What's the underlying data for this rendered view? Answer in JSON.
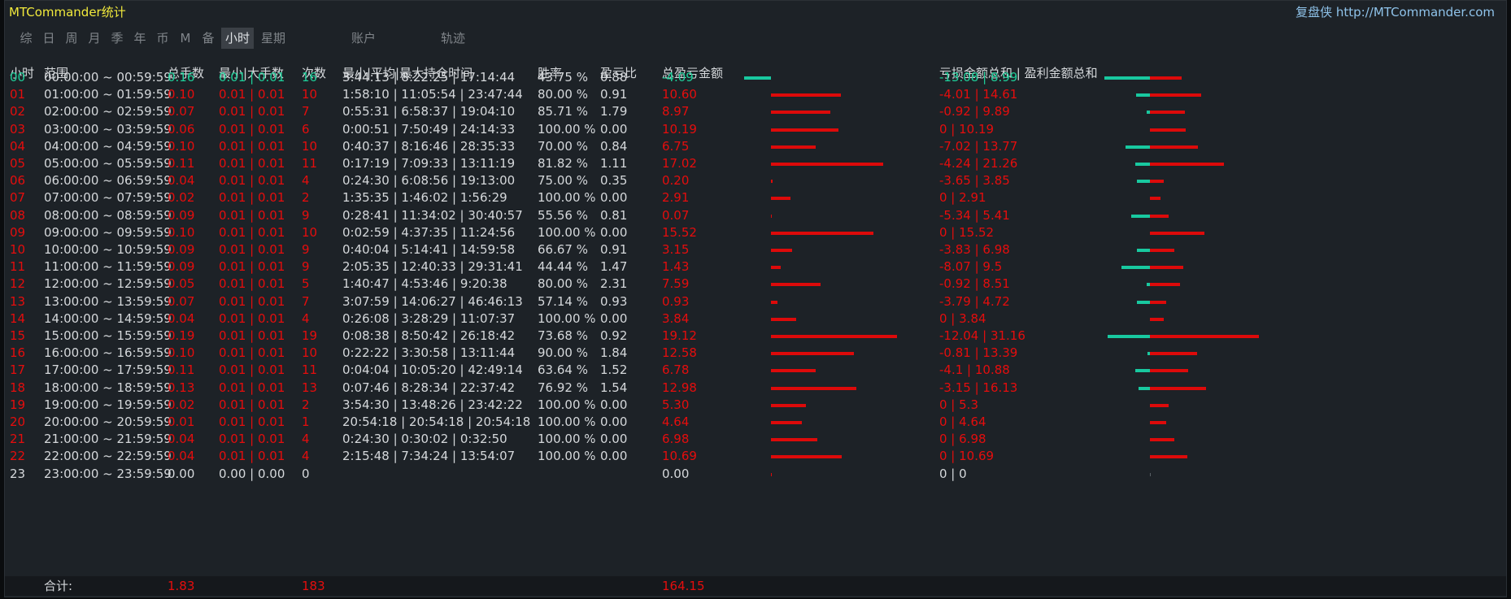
{
  "app": {
    "title": "MTCommander统计",
    "site": "复盘侠 http://MTCommander.com"
  },
  "tabs": [
    {
      "label": "综"
    },
    {
      "label": "日"
    },
    {
      "label": "周"
    },
    {
      "label": "月"
    },
    {
      "label": "季"
    },
    {
      "label": "年"
    },
    {
      "label": "币"
    },
    {
      "label": "M"
    },
    {
      "label": "备"
    },
    {
      "label": "小时",
      "active": true
    },
    {
      "label": "星期"
    },
    {
      "label": "账户"
    },
    {
      "label": "轨迹"
    }
  ],
  "colors": {
    "positive": "#1ecf9a",
    "negative": "#e50d0d",
    "neutral": "#d5d8db",
    "bar_positive": "#18c9a0",
    "bar_negative": "#dd0a0a"
  },
  "columns": [
    "小时",
    "范围",
    "总手数",
    "最小|大手数",
    "次数",
    "最小|平均|最大持仓时间",
    "胜率",
    "盈亏比",
    "总盈亏金额",
    "亏损金额总和 | 盈利金额总和"
  ],
  "rows": [
    {
      "hour": "00",
      "range": "00:00:00 ~ 00:59:59",
      "lots": "0.16",
      "minmax": "0.01 | 0.01",
      "count": "16",
      "hold": "3:44:13 | 8:22:25 | 17:14:44",
      "win": "43.75 %",
      "ratio": "0.88",
      "pnl": "-4.09",
      "lossgain": "-13.08 | 8.99",
      "pnl_value": -4.09,
      "loss_value": -13.08,
      "gain_value": 8.99,
      "tone": "pos"
    },
    {
      "hour": "01",
      "range": "01:00:00 ~ 01:59:59",
      "lots": "0.10",
      "minmax": "0.01 | 0.01",
      "count": "10",
      "hold": "1:58:10 | 11:05:54 | 23:47:44",
      "win": "80.00 %",
      "ratio": "0.91",
      "pnl": "10.60",
      "lossgain": "-4.01 | 14.61",
      "pnl_value": 10.6,
      "loss_value": -4.01,
      "gain_value": 14.61,
      "tone": "neg"
    },
    {
      "hour": "02",
      "range": "02:00:00 ~ 02:59:59",
      "lots": "0.07",
      "minmax": "0.01 | 0.01",
      "count": "7",
      "hold": "0:55:31 | 6:58:37 | 19:04:10",
      "win": "85.71 %",
      "ratio": "1.79",
      "pnl": "8.97",
      "lossgain": "-0.92 | 9.89",
      "pnl_value": 8.97,
      "loss_value": -0.92,
      "gain_value": 9.89,
      "tone": "neg"
    },
    {
      "hour": "03",
      "range": "03:00:00 ~ 03:59:59",
      "lots": "0.06",
      "minmax": "0.01 | 0.01",
      "count": "6",
      "hold": "0:00:51 | 7:50:49 | 24:14:33",
      "win": "100.00 %",
      "ratio": "0.00",
      "pnl": "10.19",
      "lossgain": "0 | 10.19",
      "pnl_value": 10.19,
      "loss_value": 0,
      "gain_value": 10.19,
      "tone": "neg"
    },
    {
      "hour": "04",
      "range": "04:00:00 ~ 04:59:59",
      "lots": "0.10",
      "minmax": "0.01 | 0.01",
      "count": "10",
      "hold": "0:40:37 | 8:16:46 | 28:35:33",
      "win": "70.00 %",
      "ratio": "0.84",
      "pnl": "6.75",
      "lossgain": "-7.02 | 13.77",
      "pnl_value": 6.75,
      "loss_value": -7.02,
      "gain_value": 13.77,
      "tone": "neg"
    },
    {
      "hour": "05",
      "range": "05:00:00 ~ 05:59:59",
      "lots": "0.11",
      "minmax": "0.01 | 0.01",
      "count": "11",
      "hold": "0:17:19 | 7:09:33 | 13:11:19",
      "win": "81.82 %",
      "ratio": "1.11",
      "pnl": "17.02",
      "lossgain": "-4.24 | 21.26",
      "pnl_value": 17.02,
      "loss_value": -4.24,
      "gain_value": 21.26,
      "tone": "neg"
    },
    {
      "hour": "06",
      "range": "06:00:00 ~ 06:59:59",
      "lots": "0.04",
      "minmax": "0.01 | 0.01",
      "count": "4",
      "hold": "0:24:30 | 6:08:56 | 19:13:00",
      "win": "75.00 %",
      "ratio": "0.35",
      "pnl": "0.20",
      "lossgain": "-3.65 | 3.85",
      "pnl_value": 0.2,
      "loss_value": -3.65,
      "gain_value": 3.85,
      "tone": "neg"
    },
    {
      "hour": "07",
      "range": "07:00:00 ~ 07:59:59",
      "lots": "0.02",
      "minmax": "0.01 | 0.01",
      "count": "2",
      "hold": "1:35:35 | 1:46:02 | 1:56:29",
      "win": "100.00 %",
      "ratio": "0.00",
      "pnl": "2.91",
      "lossgain": "0 | 2.91",
      "pnl_value": 2.91,
      "loss_value": 0,
      "gain_value": 2.91,
      "tone": "neg"
    },
    {
      "hour": "08",
      "range": "08:00:00 ~ 08:59:59",
      "lots": "0.09",
      "minmax": "0.01 | 0.01",
      "count": "9",
      "hold": "0:28:41 | 11:34:02 | 30:40:57",
      "win": "55.56 %",
      "ratio": "0.81",
      "pnl": "0.07",
      "lossgain": "-5.34 | 5.41",
      "pnl_value": 0.07,
      "loss_value": -5.34,
      "gain_value": 5.41,
      "tone": "neg"
    },
    {
      "hour": "09",
      "range": "09:00:00 ~ 09:59:59",
      "lots": "0.10",
      "minmax": "0.01 | 0.01",
      "count": "10",
      "hold": "0:02:59 | 4:37:35 | 11:24:56",
      "win": "100.00 %",
      "ratio": "0.00",
      "pnl": "15.52",
      "lossgain": "0 | 15.52",
      "pnl_value": 15.52,
      "loss_value": 0,
      "gain_value": 15.52,
      "tone": "neg"
    },
    {
      "hour": "10",
      "range": "10:00:00 ~ 10:59:59",
      "lots": "0.09",
      "minmax": "0.01 | 0.01",
      "count": "9",
      "hold": "0:40:04 | 5:14:41 | 14:59:58",
      "win": "66.67 %",
      "ratio": "0.91",
      "pnl": "3.15",
      "lossgain": "-3.83 | 6.98",
      "pnl_value": 3.15,
      "loss_value": -3.83,
      "gain_value": 6.98,
      "tone": "neg"
    },
    {
      "hour": "11",
      "range": "11:00:00 ~ 11:59:59",
      "lots": "0.09",
      "minmax": "0.01 | 0.01",
      "count": "9",
      "hold": "2:05:35 | 12:40:33 | 29:31:41",
      "win": "44.44 %",
      "ratio": "1.47",
      "pnl": "1.43",
      "lossgain": "-8.07 | 9.5",
      "pnl_value": 1.43,
      "loss_value": -8.07,
      "gain_value": 9.5,
      "tone": "neg"
    },
    {
      "hour": "12",
      "range": "12:00:00 ~ 12:59:59",
      "lots": "0.05",
      "minmax": "0.01 | 0.01",
      "count": "5",
      "hold": "1:40:47 | 4:53:46 | 9:20:38",
      "win": "80.00 %",
      "ratio": "2.31",
      "pnl": "7.59",
      "lossgain": "-0.92 | 8.51",
      "pnl_value": 7.59,
      "loss_value": -0.92,
      "gain_value": 8.51,
      "tone": "neg"
    },
    {
      "hour": "13",
      "range": "13:00:00 ~ 13:59:59",
      "lots": "0.07",
      "minmax": "0.01 | 0.01",
      "count": "7",
      "hold": "3:07:59 | 14:06:27 | 46:46:13",
      "win": "57.14 %",
      "ratio": "0.93",
      "pnl": "0.93",
      "lossgain": "-3.79 | 4.72",
      "pnl_value": 0.93,
      "loss_value": -3.79,
      "gain_value": 4.72,
      "tone": "neg"
    },
    {
      "hour": "14",
      "range": "14:00:00 ~ 14:59:59",
      "lots": "0.04",
      "minmax": "0.01 | 0.01",
      "count": "4",
      "hold": "0:26:08 | 3:28:29 | 11:07:37",
      "win": "100.00 %",
      "ratio": "0.00",
      "pnl": "3.84",
      "lossgain": "0 | 3.84",
      "pnl_value": 3.84,
      "loss_value": 0,
      "gain_value": 3.84,
      "tone": "neg"
    },
    {
      "hour": "15",
      "range": "15:00:00 ~ 15:59:59",
      "lots": "0.19",
      "minmax": "0.01 | 0.01",
      "count": "19",
      "hold": "0:08:38 | 8:50:42 | 26:18:42",
      "win": "73.68 %",
      "ratio": "0.92",
      "pnl": "19.12",
      "lossgain": "-12.04 | 31.16",
      "pnl_value": 19.12,
      "loss_value": -12.04,
      "gain_value": 31.16,
      "tone": "neg"
    },
    {
      "hour": "16",
      "range": "16:00:00 ~ 16:59:59",
      "lots": "0.10",
      "minmax": "0.01 | 0.01",
      "count": "10",
      "hold": "0:22:22 | 3:30:58 | 13:11:44",
      "win": "90.00 %",
      "ratio": "1.84",
      "pnl": "12.58",
      "lossgain": "-0.81 | 13.39",
      "pnl_value": 12.58,
      "loss_value": -0.81,
      "gain_value": 13.39,
      "tone": "neg"
    },
    {
      "hour": "17",
      "range": "17:00:00 ~ 17:59:59",
      "lots": "0.11",
      "minmax": "0.01 | 0.01",
      "count": "11",
      "hold": "0:04:04 | 10:05:20 | 42:49:14",
      "win": "63.64 %",
      "ratio": "1.52",
      "pnl": "6.78",
      "lossgain": "-4.1 | 10.88",
      "pnl_value": 6.78,
      "loss_value": -4.1,
      "gain_value": 10.88,
      "tone": "neg"
    },
    {
      "hour": "18",
      "range": "18:00:00 ~ 18:59:59",
      "lots": "0.13",
      "minmax": "0.01 | 0.01",
      "count": "13",
      "hold": "0:07:46 | 8:28:34 | 22:37:42",
      "win": "76.92 %",
      "ratio": "1.54",
      "pnl": "12.98",
      "lossgain": "-3.15 | 16.13",
      "pnl_value": 12.98,
      "loss_value": -3.15,
      "gain_value": 16.13,
      "tone": "neg"
    },
    {
      "hour": "19",
      "range": "19:00:00 ~ 19:59:59",
      "lots": "0.02",
      "minmax": "0.01 | 0.01",
      "count": "2",
      "hold": "3:54:30 | 13:48:26 | 23:42:22",
      "win": "100.00 %",
      "ratio": "0.00",
      "pnl": "5.30",
      "lossgain": "0 | 5.3",
      "pnl_value": 5.3,
      "loss_value": 0,
      "gain_value": 5.3,
      "tone": "neg"
    },
    {
      "hour": "20",
      "range": "20:00:00 ~ 20:59:59",
      "lots": "0.01",
      "minmax": "0.01 | 0.01",
      "count": "1",
      "hold": "20:54:18 | 20:54:18 | 20:54:18",
      "win": "100.00 %",
      "ratio": "0.00",
      "pnl": "4.64",
      "lossgain": "0 | 4.64",
      "pnl_value": 4.64,
      "loss_value": 0,
      "gain_value": 4.64,
      "tone": "neg"
    },
    {
      "hour": "21",
      "range": "21:00:00 ~ 21:59:59",
      "lots": "0.04",
      "minmax": "0.01 | 0.01",
      "count": "4",
      "hold": "0:24:30 | 0:30:02 | 0:32:50",
      "win": "100.00 %",
      "ratio": "0.00",
      "pnl": "6.98",
      "lossgain": "0 | 6.98",
      "pnl_value": 6.98,
      "loss_value": 0,
      "gain_value": 6.98,
      "tone": "neg"
    },
    {
      "hour": "22",
      "range": "22:00:00 ~ 22:59:59",
      "lots": "0.04",
      "minmax": "0.01 | 0.01",
      "count": "4",
      "hold": "2:15:48 | 7:34:24 | 13:54:07",
      "win": "100.00 %",
      "ratio": "0.00",
      "pnl": "10.69",
      "lossgain": "0 | 10.69",
      "pnl_value": 10.69,
      "loss_value": 0,
      "gain_value": 10.69,
      "tone": "neg"
    },
    {
      "hour": "23",
      "range": "23:00:00 ~ 23:59:59",
      "lots": "0.00",
      "minmax": "0.00 | 0.00",
      "count": "0",
      "hold": "",
      "win": "",
      "ratio": "",
      "pnl": "0.00",
      "lossgain": "0 | 0",
      "pnl_value": 0,
      "loss_value": 0,
      "gain_value": 0,
      "tone": "neutral"
    }
  ],
  "totals": {
    "label": "合计:",
    "lots": "1.83",
    "count": "183",
    "pnl": "164.15"
  }
}
